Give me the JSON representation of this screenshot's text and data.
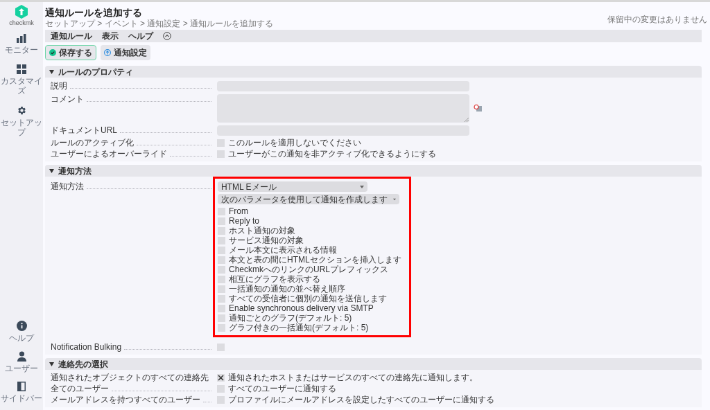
{
  "sidebar": {
    "logo_text": "checkmk",
    "top_items": [
      {
        "label": "モニター",
        "kind": "monitor"
      },
      {
        "label": "カスタマイズ",
        "kind": "customize"
      },
      {
        "label": "セットアップ",
        "kind": "setup"
      }
    ],
    "bottom_items": [
      {
        "label": "ヘルプ",
        "kind": "help"
      },
      {
        "label": "ユーザー",
        "kind": "user"
      },
      {
        "label": "サイドバー",
        "kind": "sidebar"
      }
    ]
  },
  "page": {
    "title": "通知ルールを追加する",
    "breadcrumb": "セットアップ > イベント > 通知設定 > 通知ルールを追加する",
    "pending": "保留中の変更はありません"
  },
  "menu": [
    "通知ルール",
    "表示",
    "ヘルプ"
  ],
  "actions": [
    {
      "label": "保存する",
      "kind": "save"
    },
    {
      "label": "通知設定",
      "kind": "nav"
    }
  ],
  "sections": [
    {
      "title": "ルールのプロパティ",
      "expanded": true,
      "rows": [
        {
          "label": "説明",
          "kind": "text"
        },
        {
          "label": "コメント",
          "kind": "textarea"
        },
        {
          "label": "ドキュメントURL",
          "kind": "text"
        },
        {
          "label": "ルールのアクティブ化",
          "kind": "checkbox",
          "checked": false,
          "text": "このルールを適用しないでください"
        },
        {
          "label": "ユーザーによるオーバーライド",
          "kind": "checkbox",
          "checked": false,
          "text": "ユーザーがこの通知を非アクティブ化できるようにする"
        }
      ]
    },
    {
      "title": "通知方法",
      "expanded": true,
      "rows": [
        {
          "label": "通知方法",
          "kind": "method",
          "highlighted": true,
          "method": "HTML Eメール",
          "mode": "次のパラメータを使用して通知を作成します",
          "options": [
            {
              "text": "From",
              "checked": false
            },
            {
              "text": "Reply to",
              "checked": false
            },
            {
              "text": "ホスト通知の対象",
              "checked": false
            },
            {
              "text": "サービス通知の対象",
              "checked": false
            },
            {
              "text": "メール本文に表示される情報",
              "checked": false
            },
            {
              "text": "本文と表の間にHTMLセクションを挿入します",
              "checked": false
            },
            {
              "text": "CheckmkへのリンクのURLプレフィックス",
              "checked": false
            },
            {
              "text": "相互にグラフを表示する",
              "checked": false
            },
            {
              "text": "一括通知の通知の並べ替え順序",
              "checked": false
            },
            {
              "text": "すべての受信者に個別の通知を送信します",
              "checked": false
            },
            {
              "text": "Enable synchronous delivery via SMTP",
              "checked": false
            },
            {
              "text": "通知ごとのグラフ(デフォルト: 5)",
              "checked": false
            },
            {
              "text": "グラフ付きの一括通知(デフォルト: 5)",
              "checked": false
            }
          ]
        },
        {
          "label": "Notification Bulking",
          "kind": "checkbox",
          "checked": false
        }
      ]
    },
    {
      "title": "連絡先の選択",
      "expanded": true,
      "rows": [
        {
          "label": "通知されたオブジェクトのすべての連絡先",
          "kind": "checkbox",
          "checked": true,
          "text": "通知されたホストまたはサービスのすべての連絡先に通知します。"
        },
        {
          "label": "全てのユーザー",
          "kind": "checkbox",
          "checked": false,
          "text": "すべてのユーザーに通知する"
        },
        {
          "label": "メールアドレスを持つすべてのユーザー",
          "kind": "checkbox",
          "checked": false,
          "text": "プロファイルにメールアドレスを設定したすべてのユーザーに通知する"
        }
      ]
    }
  ]
}
